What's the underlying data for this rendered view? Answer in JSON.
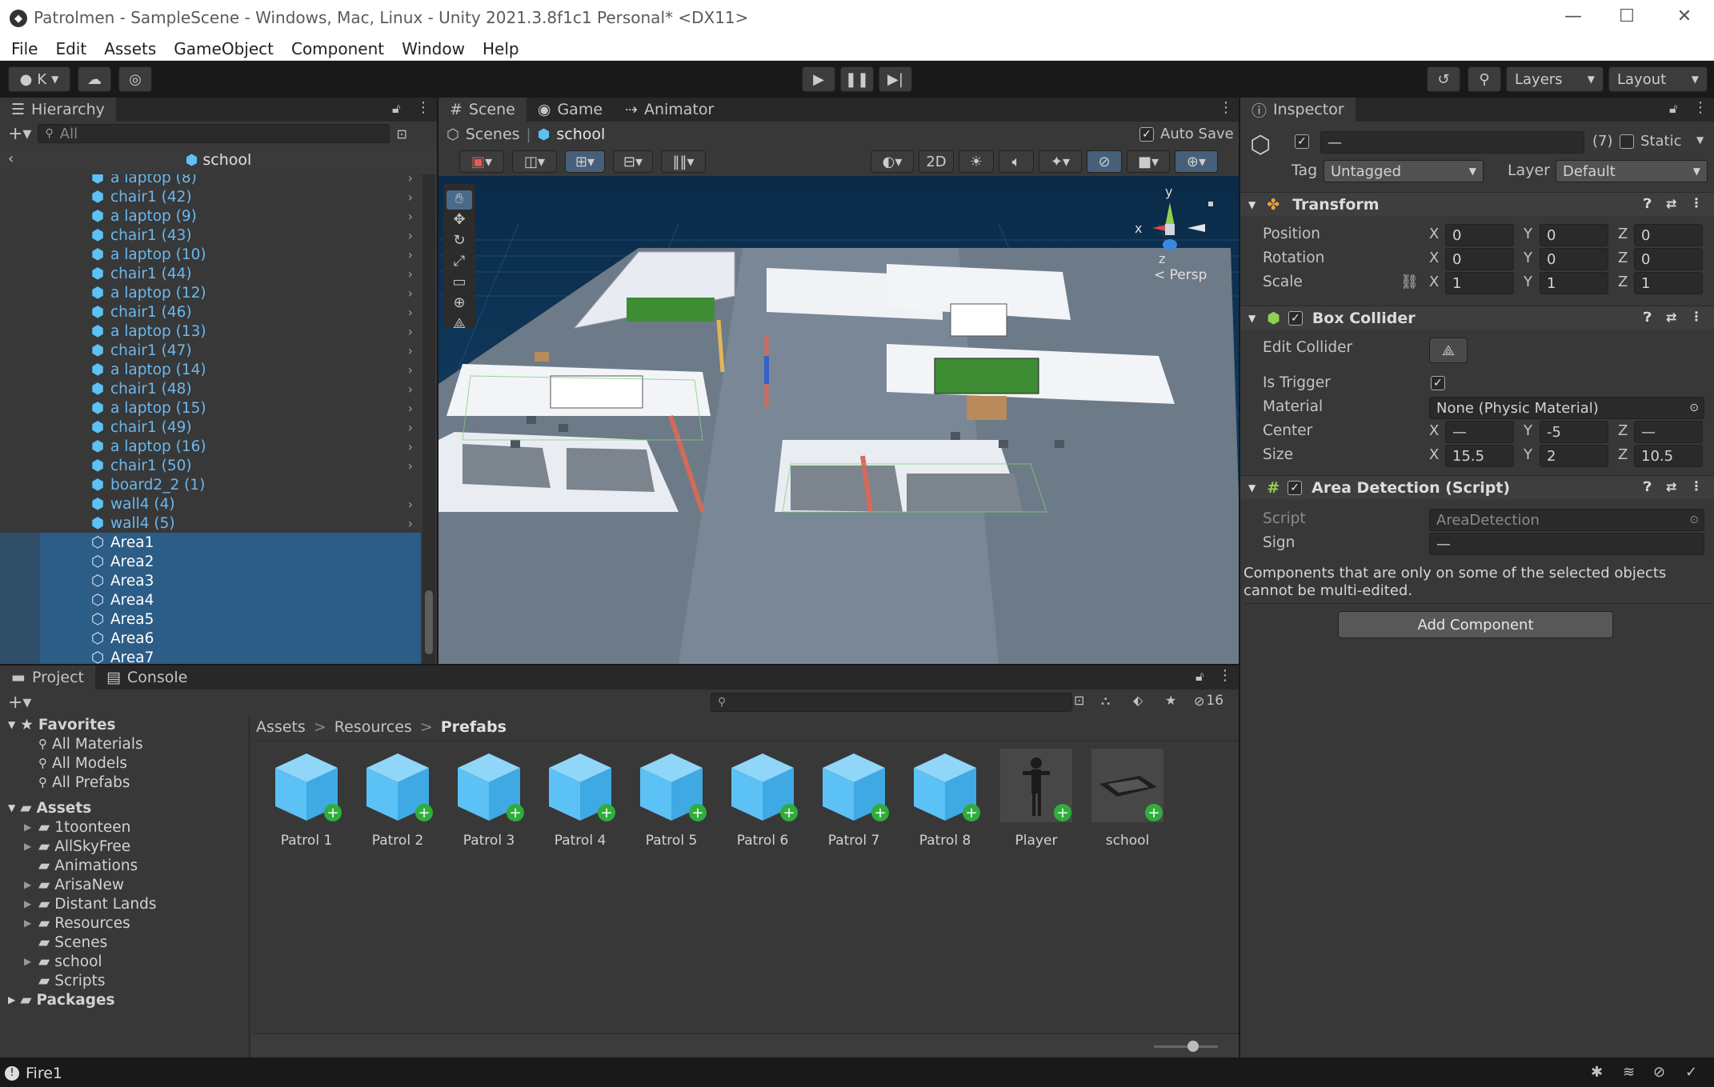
{
  "window": {
    "title": "Patrolmen - SampleScene - Windows, Mac, Linux - Unity 2021.3.8f1c1 Personal* <DX11>",
    "controls": [
      "—",
      "☐",
      "✕"
    ]
  },
  "menu": [
    "File",
    "Edit",
    "Assets",
    "GameObject",
    "Component",
    "Window",
    "Help"
  ],
  "toolbar": {
    "account": "K",
    "layers": "Layers",
    "layout": "Layout"
  },
  "hierarchy": {
    "tab": "Hierarchy",
    "search_placeholder": "All",
    "scene": "school",
    "rows": [
      {
        "label": "a laptop (8)",
        "sel": false,
        "arrow": true
      },
      {
        "label": "chair1 (42)",
        "sel": false,
        "arrow": true
      },
      {
        "label": "a laptop (9)",
        "sel": false,
        "arrow": true
      },
      {
        "label": "chair1 (43)",
        "sel": false,
        "arrow": true
      },
      {
        "label": "a laptop (10)",
        "sel": false,
        "arrow": true
      },
      {
        "label": "chair1 (44)",
        "sel": false,
        "arrow": true
      },
      {
        "label": "a laptop (12)",
        "sel": false,
        "arrow": true
      },
      {
        "label": "chair1 (46)",
        "sel": false,
        "arrow": true
      },
      {
        "label": "a laptop (13)",
        "sel": false,
        "arrow": true
      },
      {
        "label": "chair1 (47)",
        "sel": false,
        "arrow": true
      },
      {
        "label": "a laptop (14)",
        "sel": false,
        "arrow": true
      },
      {
        "label": "chair1 (48)",
        "sel": false,
        "arrow": true
      },
      {
        "label": "a laptop (15)",
        "sel": false,
        "arrow": true
      },
      {
        "label": "chair1 (49)",
        "sel": false,
        "arrow": true
      },
      {
        "label": "a laptop (16)",
        "sel": false,
        "arrow": true
      },
      {
        "label": "chair1 (50)",
        "sel": false,
        "arrow": true
      },
      {
        "label": "board2_2 (1)",
        "sel": false,
        "arrow": false
      },
      {
        "label": "wall4 (4)",
        "sel": false,
        "arrow": true
      },
      {
        "label": "wall4 (5)",
        "sel": false,
        "arrow": true
      },
      {
        "label": "Area1",
        "sel": true,
        "arrow": false
      },
      {
        "label": "Area2",
        "sel": true,
        "arrow": false
      },
      {
        "label": "Area3",
        "sel": true,
        "arrow": false
      },
      {
        "label": "Area4",
        "sel": true,
        "arrow": false
      },
      {
        "label": "Area5",
        "sel": true,
        "arrow": false
      },
      {
        "label": "Area6",
        "sel": true,
        "arrow": false
      },
      {
        "label": "Area7",
        "sel": true,
        "arrow": false
      }
    ]
  },
  "scene_view": {
    "tabs": [
      "Scene",
      "Game",
      "Animator"
    ],
    "breadcrumb_root": "Scenes",
    "breadcrumb_scene": "school",
    "auto_save": "Auto Save",
    "mode_2d": "2D",
    "persp": "< Persp",
    "gizmo_axes": {
      "y": "y",
      "x": "x",
      "z": "z"
    }
  },
  "project": {
    "tabs": [
      "Project",
      "Console"
    ],
    "hidden_count": "16",
    "favorites_label": "Favorites",
    "favorites": [
      "All Materials",
      "All Models",
      "All Prefabs"
    ],
    "assets_label": "Assets",
    "assets_children": [
      {
        "label": "1toonteen",
        "arrow": true
      },
      {
        "label": "AllSkyFree",
        "arrow": true
      },
      {
        "label": "Animations",
        "arrow": false
      },
      {
        "label": "ArisaNew",
        "arrow": true
      },
      {
        "label": "Distant Lands",
        "arrow": true
      },
      {
        "label": "Resources",
        "arrow": true
      },
      {
        "label": "Scenes",
        "arrow": false
      },
      {
        "label": "school",
        "arrow": true
      },
      {
        "label": "Scripts",
        "arrow": false
      }
    ],
    "packages_label": "Packages",
    "breadcrumb": [
      "Assets",
      "Resources",
      "Prefabs"
    ],
    "prefabs": [
      "Patrol 1",
      "Patrol 2",
      "Patrol 3",
      "Patrol 4",
      "Patrol 5",
      "Patrol 6",
      "Patrol 7",
      "Patrol 8",
      "Player",
      "school"
    ]
  },
  "inspector": {
    "tab": "Inspector",
    "name_value": "—",
    "count": "(7)",
    "static_label": "Static",
    "tag_label": "Tag",
    "tag_value": "Untagged",
    "layer_label": "Layer",
    "layer_value": "Default",
    "transform": {
      "title": "Transform",
      "position_label": "Position",
      "position": [
        "0",
        "0",
        "0"
      ],
      "rotation_label": "Rotation",
      "rotation": [
        "0",
        "0",
        "0"
      ],
      "scale_label": "Scale",
      "scale": [
        "1",
        "1",
        "1"
      ]
    },
    "box_collider": {
      "title": "Box Collider",
      "edit_label": "Edit Collider",
      "trigger_label": "Is Trigger",
      "material_label": "Material",
      "material_value": "None (Physic Material)",
      "center_label": "Center",
      "center": [
        "—",
        "-5",
        "—"
      ],
      "size_label": "Size",
      "size": [
        "15.5",
        "2",
        "10.5"
      ]
    },
    "area_detection": {
      "title": "Area Detection (Script)",
      "script_label": "Script",
      "script_value": "AreaDetection",
      "sign_label": "Sign",
      "sign_value": "—"
    },
    "multi_edit_note": "Components that are only on some of the selected objects cannot be multi-edited.",
    "add_component": "Add Component"
  },
  "status": {
    "message": "Fire1"
  },
  "axis_letters": {
    "x": "X",
    "y": "Y",
    "z": "Z"
  }
}
